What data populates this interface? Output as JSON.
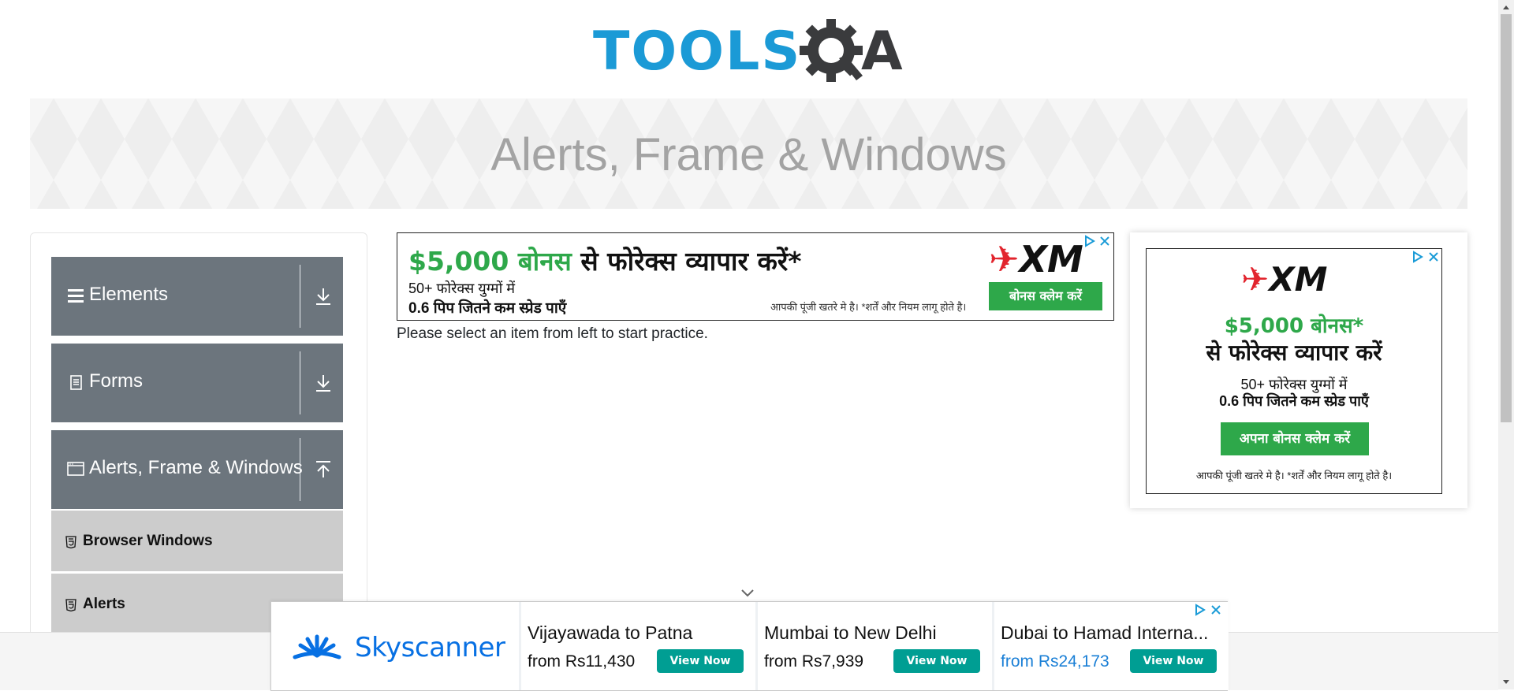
{
  "logo": {
    "text": "TOOLS",
    "text_tail": "A",
    "brand_blue": "#1b9ad6",
    "brand_dark": "#3a3b3d"
  },
  "banner": {
    "title": "Alerts, Frame & Windows"
  },
  "sidebar": {
    "groups": [
      {
        "label": "Elements",
        "icon": "hamburger-icon",
        "arrow": "download-arrow-icon",
        "expanded": false
      },
      {
        "label": "Forms",
        "icon": "document-icon",
        "arrow": "download-arrow-icon",
        "expanded": false
      },
      {
        "label": "Alerts, Frame & Windows",
        "icon": "window-icon",
        "arrow": "upload-arrow-icon",
        "expanded": true
      }
    ],
    "items": [
      {
        "label": "Browser Windows",
        "icon": "html5-icon"
      },
      {
        "label": "Alerts",
        "icon": "html5-icon"
      }
    ],
    "header_color": "#6c757d",
    "item_color": "#cccccc"
  },
  "ad_mid": {
    "headline_green": "$5,000 बोनस",
    "headline_rest": " से फोरेक्स व्यापार करें*",
    "line2": "50+ फोरेक्स युग्मों में",
    "line3": "0.6 पिप जितने कम स्प्रेड पाएँ",
    "disclaimer": "आपकी पूंजी खतरे मे है। *शर्तें और नियम लागू होते है।",
    "brand": "XM",
    "button": "बोनस क्लेम करें"
  },
  "main": {
    "practice_text": "Please select an item from left to start practice."
  },
  "ad_right": {
    "brand": "XM",
    "line1": "$5,000 बोनस*",
    "line2": "से फोरेक्स व्यापार करें",
    "line3": "50+ फोरेक्स युग्मों में",
    "line4": "0.6 पिप जितने कम स्प्रेड पाएँ",
    "button": "अपना बोनस क्लेम करें",
    "disclaimer": "आपकी पूंजी खतरे मे है। *शर्तें और नियम लागू होते है।"
  },
  "ad_bottom": {
    "brand": "Skyscanner",
    "cards": [
      {
        "title": "Vijayawada to Patna",
        "price": "from Rs11,430",
        "button": "View Now"
      },
      {
        "title": "Mumbai to New Delhi",
        "price": "from Rs7,939",
        "button": "View Now"
      },
      {
        "title": "Dubai to Hamad Interna...",
        "price": "from Rs24,173",
        "button": "View Now"
      }
    ]
  }
}
